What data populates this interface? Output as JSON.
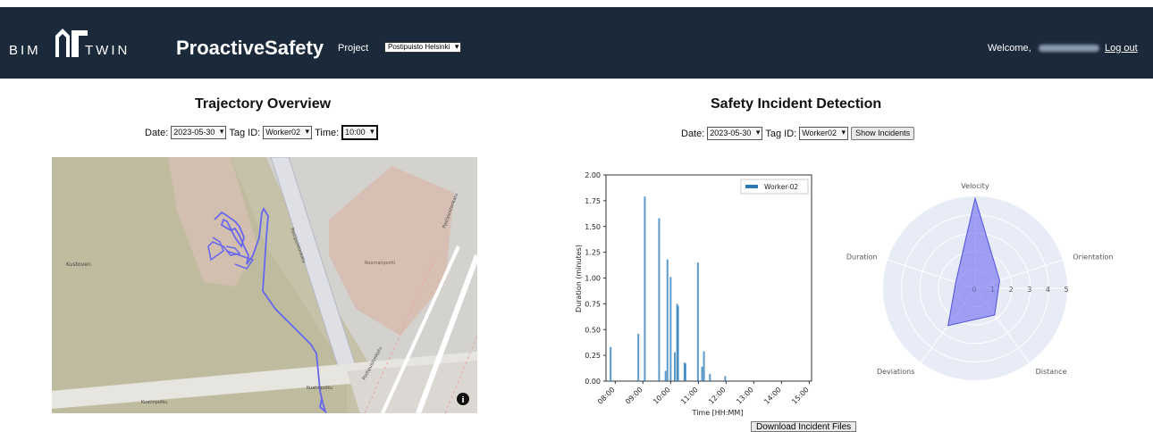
{
  "header": {
    "logo_left": "BIM",
    "logo_right": "TWIN",
    "brand": "ProactiveSafety",
    "project_label": "Project",
    "project_value": "Postipuisto Helsinki",
    "welcome": "Welcome,",
    "logout": "Log out"
  },
  "trajectory": {
    "title": "Trajectory Overview",
    "date_label": "Date:",
    "date_value": "2023-05-30",
    "tag_label": "Tag ID:",
    "tag_value": "Worker02",
    "time_label": "Time:",
    "time_value": "10:00"
  },
  "incident": {
    "title": "Safety Incident Detection",
    "date_label": "Date:",
    "date_value": "2023-05-30",
    "tag_label": "Tag ID:",
    "tag_value": "Worker02",
    "show_button": "Show Incidents",
    "download_button": "Download Incident Files"
  },
  "map": {
    "labels": [
      "Kustoven",
      "Kuatinpolku",
      "Kuatinpolku",
      "Postipuistonkatu",
      "Postipuistonkatu",
      "Postipuistonkatu",
      "Roomanportti"
    ],
    "info_icon": "info-icon"
  },
  "chart_data": [
    {
      "type": "bar",
      "legend": [
        "Worker-02"
      ],
      "xlabel": "Time [HH:MM]",
      "ylabel": "Duration (minutes)",
      "x_ticks": [
        "08:00",
        "09:00",
        "10:00",
        "11:00",
        "12:00",
        "13:00",
        "14:00",
        "15:00"
      ],
      "y_ticks": [
        "0.00",
        "0.25",
        "0.50",
        "0.75",
        "1.00",
        "1.25",
        "1.50",
        "1.75",
        "2.00"
      ],
      "ylim": [
        0,
        2.0
      ],
      "series": [
        {
          "name": "Worker-02",
          "color": "#2a7ab8",
          "points": [
            {
              "x": "07:50",
              "y": 0.33
            },
            {
              "x": "08:50",
              "y": 0.46
            },
            {
              "x": "09:04",
              "y": 1.79
            },
            {
              "x": "09:35",
              "y": 1.58
            },
            {
              "x": "09:49",
              "y": 0.1
            },
            {
              "x": "09:53",
              "y": 1.18
            },
            {
              "x": "10:00",
              "y": 1.01
            },
            {
              "x": "10:09",
              "y": 0.28
            },
            {
              "x": "10:14",
              "y": 0.75
            },
            {
              "x": "10:16",
              "y": 0.73
            },
            {
              "x": "10:30",
              "y": 0.18
            },
            {
              "x": "10:32",
              "y": 0.17
            },
            {
              "x": "10:59",
              "y": 1.15
            },
            {
              "x": "11:08",
              "y": 0.14
            },
            {
              "x": "11:12",
              "y": 0.29
            },
            {
              "x": "11:25",
              "y": 0.07
            },
            {
              "x": "11:58",
              "y": 0.05
            }
          ]
        }
      ]
    },
    {
      "type": "radar",
      "axes": [
        "Velocity",
        "Orientation",
        "Distance",
        "Deviations",
        "Duration"
      ],
      "radial_ticks": [
        "0",
        "1",
        "2",
        "3",
        "4",
        "5"
      ],
      "rlim": [
        0,
        5
      ],
      "values": [
        4.9,
        1.4,
        1.8,
        2.5,
        1.1
      ],
      "color": "#6b6bf0"
    }
  ]
}
